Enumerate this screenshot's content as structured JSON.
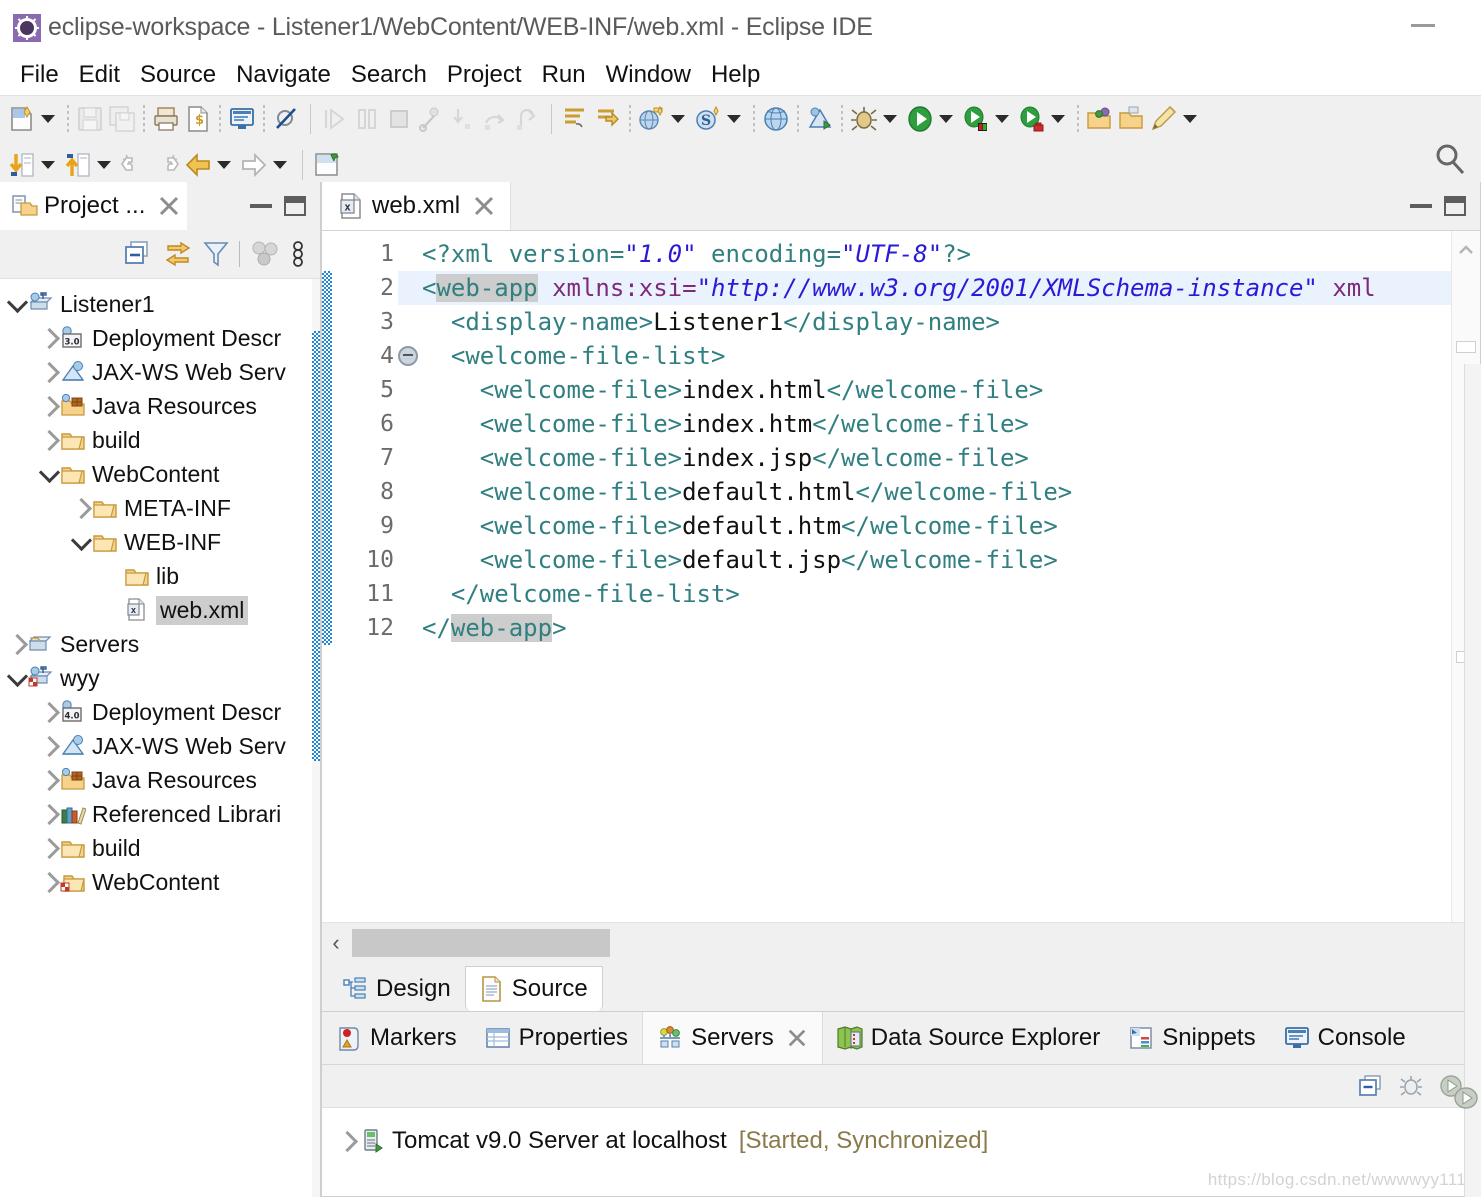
{
  "window": {
    "title": "eclipse-workspace - Listener1/WebContent/WEB-INF/web.xml - Eclipse IDE",
    "minimize_label": "Minimize",
    "app_icon": "eclipse-icon"
  },
  "menu": {
    "items": [
      "File",
      "Edit",
      "Source",
      "Navigate",
      "Search",
      "Project",
      "Run",
      "Window",
      "Help"
    ]
  },
  "toolbar": {
    "search_icon": "search-icon",
    "row1": [
      {
        "name": "new-wizard",
        "icon": "new-file-icon",
        "dropdown": true
      },
      {
        "sep": "dots"
      },
      {
        "name": "save",
        "icon": "save-icon",
        "disabled": true
      },
      {
        "name": "save-all",
        "icon": "save-all-icon",
        "disabled": true
      },
      {
        "sep": "dots"
      },
      {
        "name": "print",
        "icon": "print-icon"
      },
      {
        "name": "validate",
        "icon": "validate-icon"
      },
      {
        "sep": "dots"
      },
      {
        "name": "open-console",
        "icon": "console-icon"
      },
      {
        "sep": "dots"
      },
      {
        "name": "skip-breakpoints",
        "icon": "skip-breakpoints-icon"
      },
      {
        "sep": "line"
      },
      {
        "name": "resume",
        "icon": "resume-icon",
        "disabled": true
      },
      {
        "name": "suspend",
        "icon": "suspend-icon",
        "disabled": true
      },
      {
        "name": "terminate",
        "icon": "terminate-icon",
        "disabled": true
      },
      {
        "name": "disconnect",
        "icon": "disconnect-icon",
        "disabled": true
      },
      {
        "name": "step-into",
        "icon": "step-into-icon",
        "disabled": true
      },
      {
        "name": "step-over",
        "icon": "step-over-icon",
        "disabled": true
      },
      {
        "name": "step-return",
        "icon": "step-return-icon",
        "disabled": true
      },
      {
        "sep": "line"
      },
      {
        "name": "new-java-class",
        "icon": "java-class-icon"
      },
      {
        "name": "new-java-package",
        "icon": "java-package-icon"
      },
      {
        "sep": "dots"
      },
      {
        "name": "new-dynamic-web-project",
        "icon": "web-project-icon",
        "dropdown": true
      },
      {
        "name": "new-server",
        "icon": "server-new-icon",
        "dropdown": true
      },
      {
        "sep": "dots"
      },
      {
        "name": "open-web-browser",
        "icon": "web-browser-icon"
      },
      {
        "sep": "dots"
      },
      {
        "name": "run-ant",
        "icon": "ant-icon"
      },
      {
        "sep": "dots"
      },
      {
        "name": "debug",
        "icon": "debug-bug-icon",
        "dropdown": true
      },
      {
        "name": "run",
        "icon": "run-play-icon",
        "dropdown": true
      },
      {
        "name": "run-external-tools",
        "icon": "run-external-icon",
        "dropdown": true
      },
      {
        "name": "run-coverage",
        "icon": "coverage-icon",
        "dropdown": true
      },
      {
        "sep": "dots"
      },
      {
        "name": "open-type",
        "icon": "open-type-icon"
      },
      {
        "name": "open-task",
        "icon": "open-task-icon"
      },
      {
        "name": "new-annotation",
        "icon": "pencil-icon",
        "dropdown": true
      }
    ],
    "row2": [
      {
        "name": "next-annotation",
        "icon": "next-annotation-icon",
        "dropdown": true
      },
      {
        "name": "previous-annotation",
        "icon": "previous-annotation-icon",
        "dropdown": true
      },
      {
        "name": "last-edit-location",
        "icon": "last-edit-icon"
      },
      {
        "name": "next-edit-location",
        "icon": "next-edit-icon"
      },
      {
        "name": "back",
        "icon": "back-arrow-icon",
        "dropdown": true
      },
      {
        "name": "forward",
        "icon": "forward-arrow-icon",
        "dropdown": true
      },
      {
        "sep": "line"
      },
      {
        "name": "new-jsp-file",
        "icon": "jsp-file-icon"
      }
    ]
  },
  "project_explorer": {
    "tab_label": "Project ...",
    "tab_icon": "project-explorer-icon",
    "close_icon": "close-icon",
    "minimize_icon": "minimize-icon",
    "maximize_icon": "maximize-icon",
    "toolbar": [
      {
        "name": "collapse-all",
        "icon": "collapse-all-icon"
      },
      {
        "name": "link-with-editor",
        "icon": "link-editor-icon"
      },
      {
        "name": "filters",
        "icon": "filter-icon"
      },
      {
        "name": "working-sets",
        "icon": "working-sets-icon",
        "disabled": true
      },
      {
        "name": "view-menu",
        "icon": "view-menu-icon"
      }
    ],
    "tree": [
      {
        "label": "Listener1",
        "indent": 0,
        "twisty": "down",
        "icon": "dynamic-web-project-icon"
      },
      {
        "label": "Deployment Descr",
        "indent": 1,
        "twisty": "right",
        "icon": "deployment-descriptor-30-icon",
        "badge": "3.0"
      },
      {
        "label": "JAX-WS Web Serv",
        "indent": 1,
        "twisty": "right",
        "icon": "jaxws-icon"
      },
      {
        "label": "Java Resources",
        "indent": 1,
        "twisty": "right",
        "icon": "java-resources-icon"
      },
      {
        "label": "build",
        "indent": 1,
        "twisty": "right",
        "icon": "folder-icon"
      },
      {
        "label": "WebContent",
        "indent": 1,
        "twisty": "down",
        "icon": "folder-icon"
      },
      {
        "label": "META-INF",
        "indent": 2,
        "twisty": "right",
        "icon": "folder-icon"
      },
      {
        "label": "WEB-INF",
        "indent": 2,
        "twisty": "down",
        "icon": "folder-icon"
      },
      {
        "label": "lib",
        "indent": 3,
        "twisty": "none",
        "icon": "folder-icon"
      },
      {
        "label": "web.xml",
        "indent": 3,
        "twisty": "none",
        "icon": "xml-file-icon",
        "selected": true
      },
      {
        "label": "Servers",
        "indent": 0,
        "twisty": "right",
        "icon": "servers-folder-icon"
      },
      {
        "label": "wyy",
        "indent": 0,
        "twisty": "down",
        "icon": "dynamic-web-project-warn-icon"
      },
      {
        "label": "Deployment Descr",
        "indent": 1,
        "twisty": "right",
        "icon": "deployment-descriptor-40-icon",
        "badge": "4.0"
      },
      {
        "label": "JAX-WS Web Serv",
        "indent": 1,
        "twisty": "right",
        "icon": "jaxws-icon"
      },
      {
        "label": "Java Resources",
        "indent": 1,
        "twisty": "right",
        "icon": "java-resources-icon"
      },
      {
        "label": "Referenced Librari",
        "indent": 1,
        "twisty": "right",
        "icon": "referenced-libraries-icon"
      },
      {
        "label": "build",
        "indent": 1,
        "twisty": "right",
        "icon": "folder-icon"
      },
      {
        "label": "WebContent",
        "indent": 1,
        "twisty": "right",
        "icon": "folder-warn-icon"
      }
    ]
  },
  "editor": {
    "tab_label": "web.xml",
    "tab_icon": "xml-file-icon",
    "close_icon": "close-icon",
    "minimize_icon": "minimize-icon",
    "maximize_icon": "maximize-icon",
    "lines": [
      {
        "n": "1",
        "fold": false,
        "highlight": false,
        "parts": [
          {
            "t": "<?xml version=",
            "c": "tag"
          },
          {
            "t": "\"1.0\"",
            "c": "val"
          },
          {
            "t": " encoding=",
            "c": "tag"
          },
          {
            "t": "\"UTF-8\"",
            "c": "val"
          },
          {
            "t": "?>",
            "c": "tag"
          }
        ]
      },
      {
        "n": "2",
        "fold": true,
        "highlight": true,
        "parts": [
          {
            "t": "<",
            "c": "tag"
          },
          {
            "t": "web-app",
            "c": "tag",
            "sel": true
          },
          {
            "t": " ",
            "c": "tag"
          },
          {
            "t": "xmlns:xsi=",
            "c": "attr"
          },
          {
            "t": "\"http://www.w3.org/2001/XMLSchema-instance\"",
            "c": "val"
          },
          {
            "t": " xml",
            "c": "attr"
          }
        ]
      },
      {
        "n": "3",
        "fold": false,
        "highlight": false,
        "parts": [
          {
            "t": "  <display-name>",
            "c": "tag"
          },
          {
            "t": "Listener1",
            "c": "txt"
          },
          {
            "t": "</display-name>",
            "c": "tag"
          }
        ]
      },
      {
        "n": "4",
        "fold": true,
        "highlight": false,
        "parts": [
          {
            "t": "  <welcome-file-list>",
            "c": "tag"
          }
        ]
      },
      {
        "n": "5",
        "fold": false,
        "highlight": false,
        "parts": [
          {
            "t": "    <welcome-file>",
            "c": "tag"
          },
          {
            "t": "index.html",
            "c": "txt"
          },
          {
            "t": "</welcome-file>",
            "c": "tag"
          }
        ]
      },
      {
        "n": "6",
        "fold": false,
        "highlight": false,
        "parts": [
          {
            "t": "    <welcome-file>",
            "c": "tag"
          },
          {
            "t": "index.htm",
            "c": "txt"
          },
          {
            "t": "</welcome-file>",
            "c": "tag"
          }
        ]
      },
      {
        "n": "7",
        "fold": false,
        "highlight": false,
        "parts": [
          {
            "t": "    <welcome-file>",
            "c": "tag"
          },
          {
            "t": "index.jsp",
            "c": "txt"
          },
          {
            "t": "</welcome-file>",
            "c": "tag"
          }
        ]
      },
      {
        "n": "8",
        "fold": false,
        "highlight": false,
        "parts": [
          {
            "t": "    <welcome-file>",
            "c": "tag"
          },
          {
            "t": "default.html",
            "c": "txt"
          },
          {
            "t": "</welcome-file>",
            "c": "tag"
          }
        ]
      },
      {
        "n": "9",
        "fold": false,
        "highlight": false,
        "parts": [
          {
            "t": "    <welcome-file>",
            "c": "tag"
          },
          {
            "t": "default.htm",
            "c": "txt"
          },
          {
            "t": "</welcome-file>",
            "c": "tag"
          }
        ]
      },
      {
        "n": "10",
        "fold": false,
        "highlight": false,
        "parts": [
          {
            "t": "    <welcome-file>",
            "c": "tag"
          },
          {
            "t": "default.jsp",
            "c": "txt"
          },
          {
            "t": "</welcome-file>",
            "c": "tag"
          }
        ]
      },
      {
        "n": "11",
        "fold": false,
        "highlight": false,
        "parts": [
          {
            "t": "  </welcome-file-list>",
            "c": "tag"
          }
        ]
      },
      {
        "n": "12",
        "fold": false,
        "highlight": false,
        "parts": [
          {
            "t": "</",
            "c": "tag"
          },
          {
            "t": "web-app",
            "c": "tag",
            "sel": true
          },
          {
            "t": ">",
            "c": "tag"
          }
        ]
      }
    ],
    "hscroll": {
      "left_arrow": "‹",
      "right_arrow": "›"
    },
    "page_tabs": [
      {
        "label": "Design",
        "icon": "design-tree-icon",
        "active": false
      },
      {
        "label": "Source",
        "icon": "source-doc-icon",
        "active": true
      }
    ]
  },
  "bottom_view": {
    "tabs": [
      {
        "label": "Markers",
        "icon": "markers-icon",
        "active": false,
        "closable": false
      },
      {
        "label": "Properties",
        "icon": "properties-icon",
        "active": false,
        "closable": false
      },
      {
        "label": "Servers",
        "icon": "servers-icon",
        "active": true,
        "closable": true
      },
      {
        "label": "Data Source Explorer",
        "icon": "data-source-explorer-icon",
        "active": false,
        "closable": false
      },
      {
        "label": "Snippets",
        "icon": "snippets-icon",
        "active": false,
        "closable": false
      },
      {
        "label": "Console",
        "icon": "console-icon",
        "active": false,
        "closable": false
      }
    ],
    "toolbar": [
      {
        "name": "minimize-view",
        "icon": "minimize-view-icon"
      },
      {
        "name": "debug-server",
        "icon": "debug-bug-icon"
      },
      {
        "name": "start-server",
        "icon": "start-play-icon"
      }
    ],
    "servers": [
      {
        "name": "Tomcat v9.0 Server at localhost",
        "state": "[Started, Synchronized]",
        "icon": "tomcat-server-icon",
        "twisty": "right"
      }
    ]
  },
  "watermark": "https://blog.csdn.net/wwwwyy111",
  "colors": {
    "tag": "#317f80",
    "attribute": "#7e2a7b",
    "value": "#2a19d6",
    "text": "#111111",
    "selection": "#cdcdcd",
    "current_line": "#eaf2fd",
    "change_bar": "#1f86d9",
    "server_state": "#8a7a4a",
    "chrome": "#f0f0f0"
  }
}
